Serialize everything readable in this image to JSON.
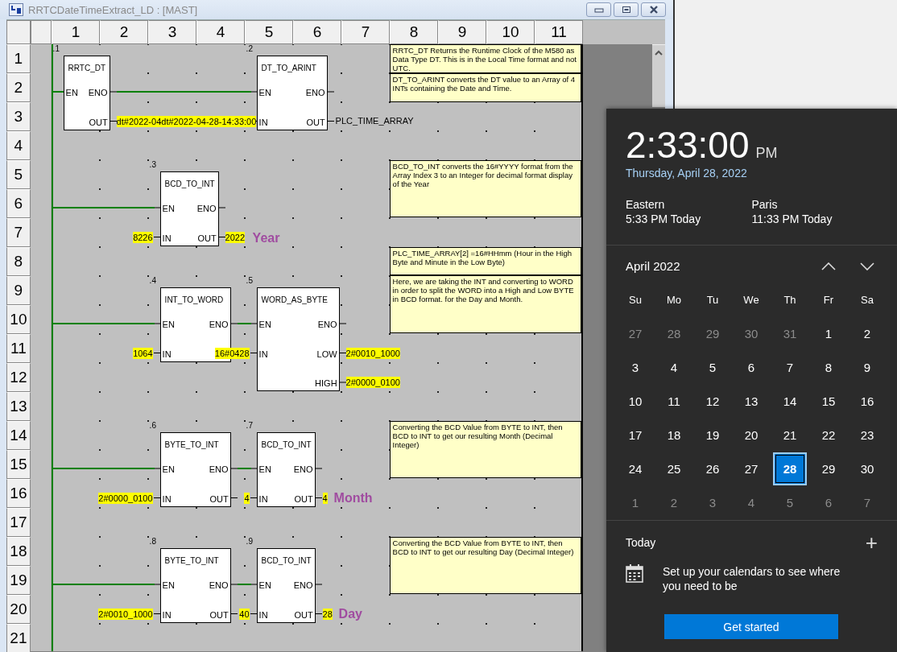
{
  "window": {
    "title": "RRTCDateTimeExtract_LD : [MAST]",
    "buttons": [
      {
        "kind": "minimize"
      },
      {
        "kind": "maximize"
      },
      {
        "kind": "close"
      }
    ]
  },
  "ladder": {
    "column_headers": [
      "1",
      "2",
      "3",
      "4",
      "5",
      "6",
      "7",
      "8",
      "9",
      "10",
      "11"
    ],
    "row_headers": [
      "1",
      "2",
      "3",
      "4",
      "5",
      "6",
      "7",
      "8",
      "9",
      "10",
      "11",
      "12",
      "13",
      "14",
      "15",
      "16",
      "17",
      "18",
      "19",
      "20",
      "21"
    ],
    "blocks": [
      {
        "number": ".1",
        "name": "RRTC_DT",
        "inputs": [
          "EN"
        ],
        "outputs": [
          "ENO",
          "OUT"
        ]
      },
      {
        "number": ".2",
        "name": "DT_TO_ARINT",
        "inputs": [
          "EN",
          "IN"
        ],
        "outputs": [
          "ENO",
          "OUT"
        ]
      },
      {
        "number": ".3",
        "name": "BCD_TO_INT",
        "inputs": [
          "EN",
          "IN"
        ],
        "outputs": [
          "ENO",
          "OUT"
        ]
      },
      {
        "number": ".4",
        "name": "INT_TO_WORD",
        "inputs": [
          "EN",
          "IN"
        ],
        "outputs": [
          "ENO"
        ]
      },
      {
        "number": ".5",
        "name": "WORD_AS_BYTE",
        "inputs": [
          "EN",
          "IN"
        ],
        "outputs": [
          "ENO",
          "LOW",
          "HIGH"
        ]
      },
      {
        "number": ".6",
        "name": "BYTE_TO_INT",
        "inputs": [
          "EN",
          "IN"
        ],
        "outputs": [
          "ENO",
          "OUT"
        ]
      },
      {
        "number": ".7",
        "name": "BCD_TO_INT",
        "inputs": [
          "EN",
          "IN"
        ],
        "outputs": [
          "ENO",
          "OUT"
        ]
      },
      {
        "number": ".8",
        "name": "BYTE_TO_INT",
        "inputs": [
          "EN",
          "IN"
        ],
        "outputs": [
          "ENO",
          "OUT"
        ]
      },
      {
        "number": ".9",
        "name": "BCD_TO_INT",
        "inputs": [
          "EN",
          "IN"
        ],
        "outputs": [
          "ENO",
          "OUT"
        ]
      }
    ],
    "values": [
      "dt#2022-04dt#2022-04-28-14:33:00",
      "8226",
      "2022",
      "1064",
      "16#0428",
      "2#0010_1000",
      "2#0000_0100",
      "2#0000_0100",
      "4",
      "4",
      "2#0010_1000",
      "40",
      "28"
    ],
    "variables": [
      "PLC_TIME_ARRAY"
    ],
    "result_labels": [
      "Year",
      "Month",
      "Day"
    ],
    "comments": [
      "RRTC_DT Returns the Runtime Clock of the M580 as Data Type DT. This is in the Local Time format and not UTC.",
      "DT_TO_ARINT converts the DT value to an Array of 4 INTs containing the Date and Time.",
      "BCD_TO_INT converts the 16#YYYY format from the Array Index 3 to an Integer for decimal format display of the Year",
      "PLC_TIME_ARRAY[2] =16#HHmm (Hour in the High Byte and Minute in the Low Byte)",
      "Here, we are taking the INT and converting to WORD in order to split the WORD into a High  and  Low BYTE in BCD format. for the Day and Month.",
      "Converting the BCD Value from BYTE to INT, then BCD to INT to get our resulting Month (Decimal Integer)",
      "Converting the BCD Value from BYTE to INT, then BCD to INT to get our resulting Day (Decimal Integer)"
    ]
  },
  "clock": {
    "time": "2:33:00",
    "ampm": "PM",
    "date": "Thursday, April 28, 2022",
    "zones": [
      {
        "name": "Eastern",
        "time": "5:33 PM Today"
      },
      {
        "name": "Paris",
        "time": "11:33 PM Today"
      }
    ]
  },
  "calendar": {
    "month": "April 2022",
    "weekdays": [
      "Su",
      "Mo",
      "Tu",
      "We",
      "Th",
      "Fr",
      "Sa"
    ],
    "weeks": [
      [
        {
          "label": "27",
          "in_month": false,
          "selected": false
        },
        {
          "label": "28",
          "in_month": false,
          "selected": false
        },
        {
          "label": "29",
          "in_month": false,
          "selected": false
        },
        {
          "label": "30",
          "in_month": false,
          "selected": false
        },
        {
          "label": "31",
          "in_month": false,
          "selected": false
        },
        {
          "label": "1",
          "in_month": true,
          "selected": false
        },
        {
          "label": "2",
          "in_month": true,
          "selected": false
        }
      ],
      [
        {
          "label": "3",
          "in_month": true,
          "selected": false
        },
        {
          "label": "4",
          "in_month": true,
          "selected": false
        },
        {
          "label": "5",
          "in_month": true,
          "selected": false
        },
        {
          "label": "6",
          "in_month": true,
          "selected": false
        },
        {
          "label": "7",
          "in_month": true,
          "selected": false
        },
        {
          "label": "8",
          "in_month": true,
          "selected": false
        },
        {
          "label": "9",
          "in_month": true,
          "selected": false
        }
      ],
      [
        {
          "label": "10",
          "in_month": true,
          "selected": false
        },
        {
          "label": "11",
          "in_month": true,
          "selected": false
        },
        {
          "label": "12",
          "in_month": true,
          "selected": false
        },
        {
          "label": "13",
          "in_month": true,
          "selected": false
        },
        {
          "label": "14",
          "in_month": true,
          "selected": false
        },
        {
          "label": "15",
          "in_month": true,
          "selected": false
        },
        {
          "label": "16",
          "in_month": true,
          "selected": false
        }
      ],
      [
        {
          "label": "17",
          "in_month": true,
          "selected": false
        },
        {
          "label": "18",
          "in_month": true,
          "selected": false
        },
        {
          "label": "19",
          "in_month": true,
          "selected": false
        },
        {
          "label": "20",
          "in_month": true,
          "selected": false
        },
        {
          "label": "21",
          "in_month": true,
          "selected": false
        },
        {
          "label": "22",
          "in_month": true,
          "selected": false
        },
        {
          "label": "23",
          "in_month": true,
          "selected": false
        }
      ],
      [
        {
          "label": "24",
          "in_month": true,
          "selected": false
        },
        {
          "label": "25",
          "in_month": true,
          "selected": false
        },
        {
          "label": "26",
          "in_month": true,
          "selected": false
        },
        {
          "label": "27",
          "in_month": true,
          "selected": false
        },
        {
          "label": "28",
          "in_month": true,
          "selected": true
        },
        {
          "label": "29",
          "in_month": true,
          "selected": false
        },
        {
          "label": "30",
          "in_month": true,
          "selected": false
        }
      ],
      [
        {
          "label": "1",
          "in_month": false,
          "selected": false
        },
        {
          "label": "2",
          "in_month": false,
          "selected": false
        },
        {
          "label": "3",
          "in_month": false,
          "selected": false
        },
        {
          "label": "4",
          "in_month": false,
          "selected": false
        },
        {
          "label": "5",
          "in_month": false,
          "selected": false
        },
        {
          "label": "6",
          "in_month": false,
          "selected": false
        },
        {
          "label": "7",
          "in_month": false,
          "selected": false
        }
      ]
    ]
  },
  "agenda": {
    "title": "Today",
    "add": "+",
    "message": "Set up your calendars to see where you need to be",
    "button": "Get started"
  }
}
